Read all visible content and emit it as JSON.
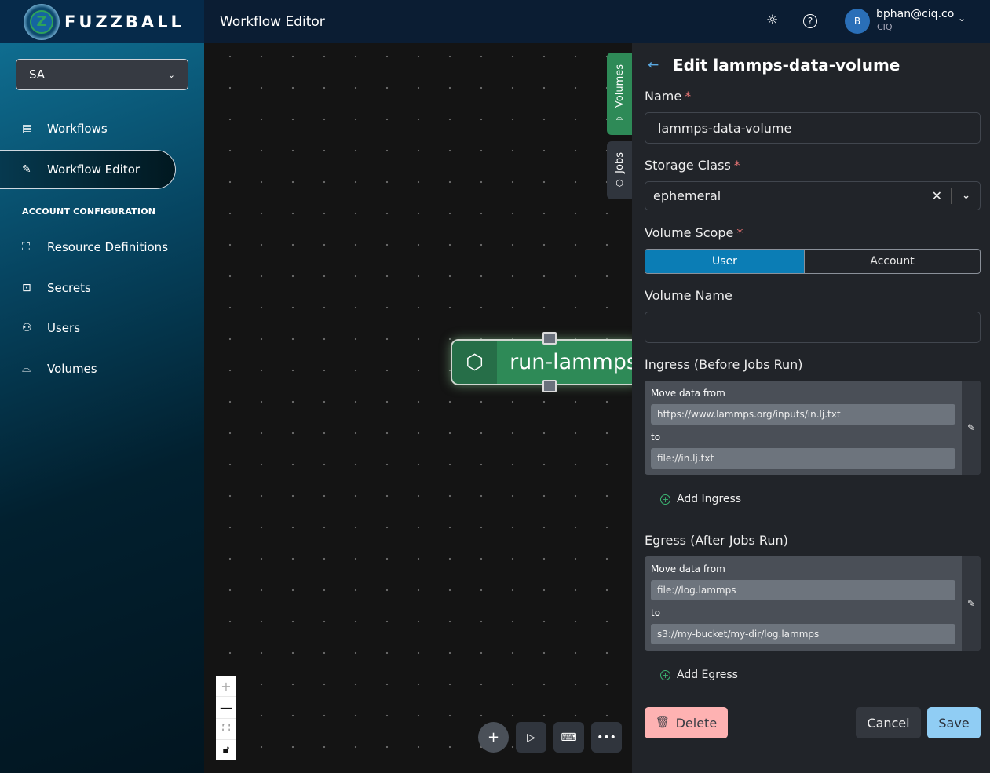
{
  "header": {
    "brand": "FUZZBALL",
    "logo_letter": "Z",
    "page_title": "Workflow Editor",
    "user": {
      "initial": "B",
      "email": "bphan@ciq.co",
      "org": "CIQ"
    }
  },
  "sidebar": {
    "org": "SA",
    "items": [
      {
        "label": "Workflows",
        "icon": "list-icon"
      },
      {
        "label": "Workflow Editor",
        "icon": "edit-icon",
        "active": true
      }
    ],
    "section": "ACCOUNT CONFIGURATION",
    "config_items": [
      {
        "label": "Resource Definitions",
        "icon": "hierarchy-icon"
      },
      {
        "label": "Secrets",
        "icon": "secret-icon"
      },
      {
        "label": "Users",
        "icon": "users-icon"
      },
      {
        "label": "Volumes",
        "icon": "drive-icon"
      }
    ]
  },
  "canvas": {
    "tabs": [
      {
        "label": "Volumes",
        "active": true
      },
      {
        "label": "Jobs"
      }
    ],
    "node": {
      "label": "run-lammps"
    }
  },
  "panel": {
    "title": "Edit lammps-data-volume",
    "name_label": "Name",
    "name_value": "lammps-data-volume",
    "storage_label": "Storage Class",
    "storage_value": "ephemeral",
    "scope_label": "Volume Scope",
    "scope_options": [
      "User",
      "Account"
    ],
    "scope_selected": "User",
    "volume_name_label": "Volume Name",
    "volume_name_value": "",
    "ingress_label": "Ingress (Before Jobs Run)",
    "ingress": {
      "from_label": "Move data from",
      "from": "https://www.lammps.org/inputs/in.lj.txt",
      "to_label": "to",
      "to": "file://in.lj.txt"
    },
    "add_ingress": "Add Ingress",
    "egress_label": "Egress (After Jobs Run)",
    "egress": {
      "from_label": "Move data from",
      "from": "file://log.lammps",
      "to_label": "to",
      "to": "s3://my-bucket/my-dir/log.lammps"
    },
    "add_egress": "Add Egress",
    "delete": "Delete",
    "cancel": "Cancel",
    "save": "Save"
  },
  "colors": {
    "accent": "#0b7db5",
    "node": "#2e8a57",
    "save": "#90cdf4",
    "delete": "#feb2b2"
  }
}
